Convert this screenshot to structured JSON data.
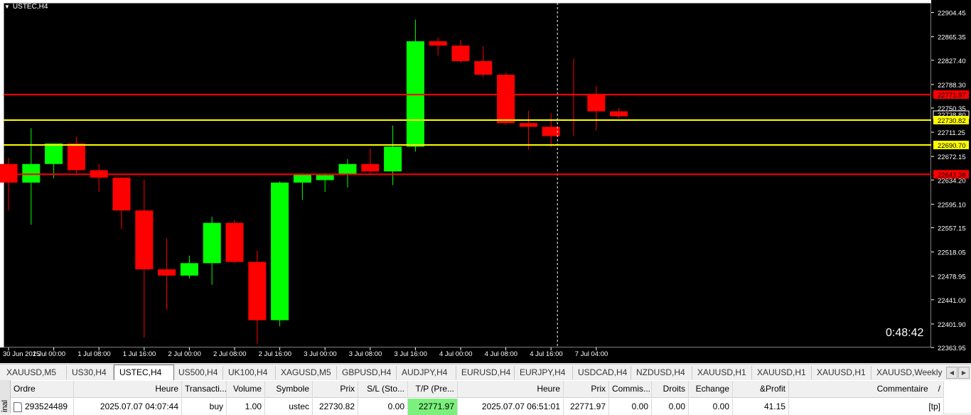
{
  "chart": {
    "title": "USTEC,H4",
    "timer": "0:48:42",
    "cursor_label": "22738.80",
    "colors": {
      "bull": "#00ff00",
      "bear": "#ff0000",
      "tp_line": "#ff0000",
      "entry_line": "#ffff00",
      "background": "#000000"
    }
  },
  "chart_data": {
    "type": "candlestick",
    "symbol": "USTEC",
    "timeframe": "H4",
    "ylim": [
      22363.95,
      22920
    ],
    "y_ticks": [
      "22904.45",
      "22865.35",
      "22827.40",
      "22788.30",
      "22750.35",
      "22711.25",
      "22672.15",
      "22634.20",
      "22595.10",
      "22557.15",
      "22518.05",
      "22478.95",
      "22441.00",
      "22401.90",
      "22363.95"
    ],
    "x_ticks": [
      "30 Jun 2025",
      "1 Jul 00:00",
      "1 Jul 08:00",
      "1 Jul 16:00",
      "2 Jul 00:00",
      "2 Jul 08:00",
      "2 Jul 16:00",
      "3 Jul 00:00",
      "3 Jul 08:00",
      "3 Jul 16:00",
      "4 Jul 00:00",
      "4 Jul 08:00",
      "4 Jul 16:00",
      "7 Jul 04:00"
    ],
    "candles": [
      {
        "o": 22660,
        "h": 22670,
        "l": 22585,
        "c": 22630
      },
      {
        "o": 22630,
        "h": 22718,
        "l": 22562,
        "c": 22660
      },
      {
        "o": 22660,
        "h": 22692,
        "l": 22637,
        "c": 22693
      },
      {
        "o": 22693,
        "h": 22704,
        "l": 22645,
        "c": 22650
      },
      {
        "o": 22650,
        "h": 22660,
        "l": 22615,
        "c": 22638
      },
      {
        "o": 22638,
        "h": 22638,
        "l": 22555,
        "c": 22585
      },
      {
        "o": 22585,
        "h": 22635,
        "l": 22380,
        "c": 22490
      },
      {
        "o": 22490,
        "h": 22540,
        "l": 22425,
        "c": 22480
      },
      {
        "o": 22480,
        "h": 22512,
        "l": 22475,
        "c": 22500
      },
      {
        "o": 22500,
        "h": 22575,
        "l": 22465,
        "c": 22565
      },
      {
        "o": 22565,
        "h": 22570,
        "l": 22500,
        "c": 22502
      },
      {
        "o": 22502,
        "h": 22520,
        "l": 22370,
        "c": 22408
      },
      {
        "o": 22408,
        "h": 22632,
        "l": 22398,
        "c": 22630
      },
      {
        "o": 22630,
        "h": 22645,
        "l": 22602,
        "c": 22644
      },
      {
        "o": 22634,
        "h": 22645,
        "l": 22615,
        "c": 22642
      },
      {
        "o": 22643,
        "h": 22668,
        "l": 22622,
        "c": 22660
      },
      {
        "o": 22660,
        "h": 22685,
        "l": 22645,
        "c": 22648
      },
      {
        "o": 22648,
        "h": 22722,
        "l": 22626,
        "c": 22688
      },
      {
        "o": 22688,
        "h": 22893,
        "l": 22680,
        "c": 22858
      },
      {
        "o": 22858,
        "h": 22864,
        "l": 22835,
        "c": 22851
      },
      {
        "o": 22851,
        "h": 22860,
        "l": 22823,
        "c": 22826
      },
      {
        "o": 22826,
        "h": 22850,
        "l": 22800,
        "c": 22804
      },
      {
        "o": 22804,
        "h": 22807,
        "l": 22723,
        "c": 22726
      },
      {
        "o": 22726,
        "h": 22746,
        "l": 22683,
        "c": 22720
      },
      {
        "o": 22720,
        "h": 22742,
        "l": 22687,
        "c": 22705
      },
      {
        "o": 22772,
        "h": 22830,
        "l": 22705,
        "c": 22771
      },
      {
        "o": 22771,
        "h": 22786,
        "l": 22714,
        "c": 22745
      },
      {
        "o": 22745,
        "h": 22750,
        "l": 22734,
        "c": 22737
      }
    ],
    "horizontal_lines": [
      {
        "name": "tp",
        "value": 22771.97,
        "label": "22771.97",
        "color": "#ff0000"
      },
      {
        "name": "entry",
        "value": 22730.82,
        "label": "22730.82",
        "color": "#ffff00"
      },
      {
        "name": "level-yellow",
        "value": 22690.7,
        "label": "22690.70",
        "color": "#ffff00"
      },
      {
        "name": "level-red",
        "value": 22643.38,
        "label": "22643.38",
        "color": "#ff0000"
      }
    ],
    "crosshair_x_label": "4 Jul 16:00"
  },
  "tabs": [
    {
      "label": "XAUUSD,M5"
    },
    {
      "label": "US30,H4"
    },
    {
      "label": "USTEC,H4",
      "active": true
    },
    {
      "label": "US500,H4"
    },
    {
      "label": "UK100,H4"
    },
    {
      "label": "XAGUSD,M5"
    },
    {
      "label": "GBPUSD,H4"
    },
    {
      "label": "AUDJPY,H4"
    },
    {
      "label": "EURUSD,H4"
    },
    {
      "label": "EURJPY,H4"
    },
    {
      "label": "USDCAD,H4"
    },
    {
      "label": "NZDUSD,H4"
    },
    {
      "label": "XAUUSD,H1"
    },
    {
      "label": "XAUUSD,H1"
    },
    {
      "label": "XAUUSD,H1"
    },
    {
      "label": "XAUUSD,Weekly"
    }
  ],
  "terminal": {
    "side_label": "inal",
    "headers": [
      "Ordre",
      "Heure",
      "Transacti...",
      "Volume",
      "Symbole",
      "Prix",
      "S/L (Sto...",
      "T/P (Pre...",
      "Heure",
      "Prix",
      "Commis...",
      "Droits",
      "Echange",
      "&Profit",
      "Commentaire"
    ],
    "sort_indicator": "/",
    "rows": [
      [
        "293524489",
        "2025.07.07 04:07:44",
        "buy",
        "1.00",
        "ustec",
        "22730.82",
        "0.00",
        "22771.97",
        "2025.07.07 06:51:01",
        "22771.97",
        "0.00",
        "0.00",
        "0.00",
        "41.15",
        "[tp]"
      ]
    ]
  }
}
